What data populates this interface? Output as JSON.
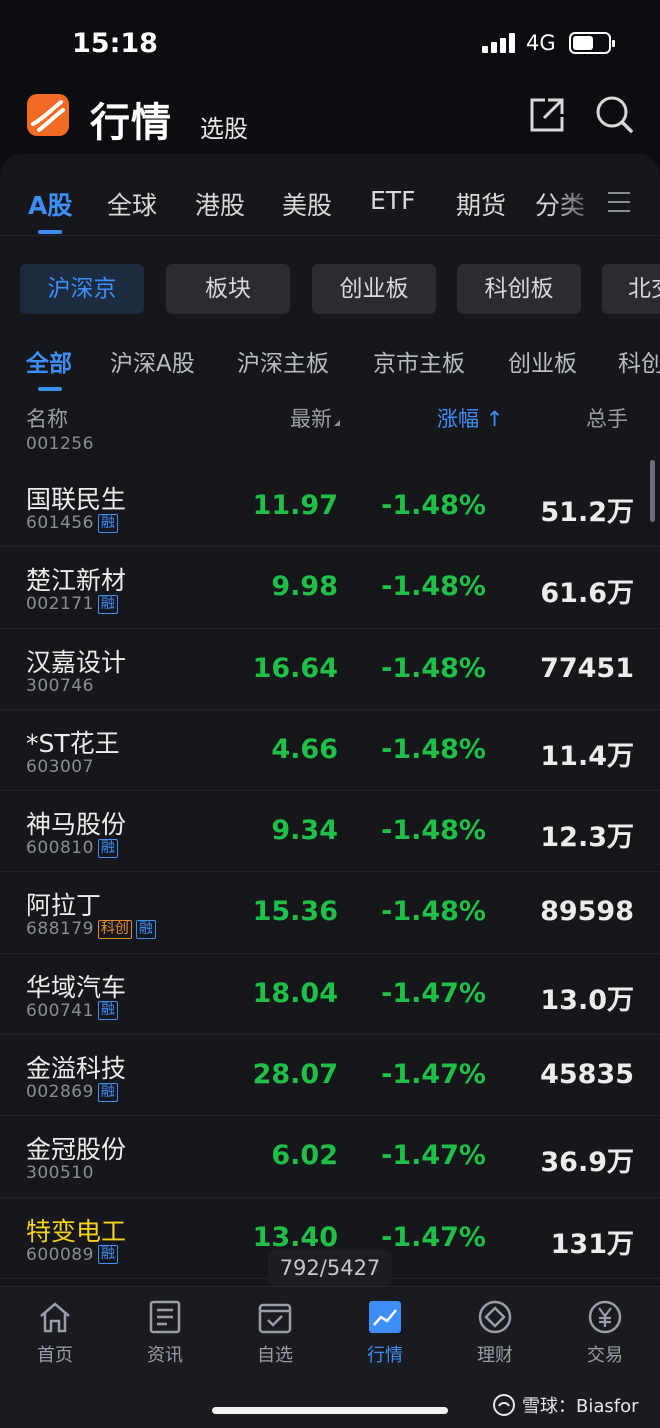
{
  "status_bar": {
    "time": "15:18",
    "network": "4G"
  },
  "header": {
    "title": "行情",
    "subtitle": "选股"
  },
  "market_tabs": [
    "A股",
    "全球",
    "港股",
    "美股",
    "ETF",
    "期货",
    "分类"
  ],
  "segments": [
    "沪深京",
    "板块",
    "创业板",
    "科创板",
    "北交"
  ],
  "sub_tabs": [
    "全部",
    "沪深A股",
    "沪深主板",
    "京市主板",
    "创业板",
    "科创"
  ],
  "columns": {
    "name": "名称",
    "latest": "最新",
    "change": "涨幅",
    "change_arrow": "↑",
    "total_hand": "总手"
  },
  "partial_code": "001256",
  "rows": [
    {
      "name": "国联民生",
      "code": "601456",
      "tags": [
        "融"
      ],
      "price": "11.97",
      "change": "-1.48%",
      "hand": "51.2万"
    },
    {
      "name": "楚江新材",
      "code": "002171",
      "tags": [
        "融"
      ],
      "price": "9.98",
      "change": "-1.48%",
      "hand": "61.6万"
    },
    {
      "name": "汉嘉设计",
      "code": "300746",
      "tags": [],
      "price": "16.64",
      "change": "-1.48%",
      "hand": "77451"
    },
    {
      "name": "*ST花王",
      "code": "603007",
      "tags": [],
      "price": "4.66",
      "change": "-1.48%",
      "hand": "11.4万"
    },
    {
      "name": "神马股份",
      "code": "600810",
      "tags": [
        "融"
      ],
      "price": "9.34",
      "change": "-1.48%",
      "hand": "12.3万"
    },
    {
      "name": "阿拉丁",
      "code": "688179",
      "tags": [
        "科创",
        "融"
      ],
      "price": "15.36",
      "change": "-1.48%",
      "hand": "89598"
    },
    {
      "name": "华域汽车",
      "code": "600741",
      "tags": [
        "融"
      ],
      "price": "18.04",
      "change": "-1.47%",
      "hand": "13.0万"
    },
    {
      "name": "金溢科技",
      "code": "002869",
      "tags": [
        "融"
      ],
      "price": "28.07",
      "change": "-1.47%",
      "hand": "45835"
    },
    {
      "name": "金冠股份",
      "code": "300510",
      "tags": [],
      "price": "6.02",
      "change": "-1.47%",
      "hand": "36.9万"
    },
    {
      "name": "特变电工",
      "code": "600089",
      "tags": [
        "融"
      ],
      "price": "13.40",
      "change": "-1.47%",
      "hand": "131万",
      "highlight": true
    }
  ],
  "page_counter": "792/5427",
  "bottom_nav": [
    {
      "label": "首页",
      "icon": "home-icon"
    },
    {
      "label": "资讯",
      "icon": "news-icon"
    },
    {
      "label": "自选",
      "icon": "watchlist-icon"
    },
    {
      "label": "行情",
      "icon": "market-icon",
      "active": true
    },
    {
      "label": "理财",
      "icon": "wealth-icon"
    },
    {
      "label": "交易",
      "icon": "trade-icon"
    }
  ],
  "watermark": "雪球：Biasfor",
  "colors": {
    "accent": "#3e8ef7",
    "down": "#20c048",
    "highlight": "#f4d31c",
    "logo": "#f26b24"
  }
}
